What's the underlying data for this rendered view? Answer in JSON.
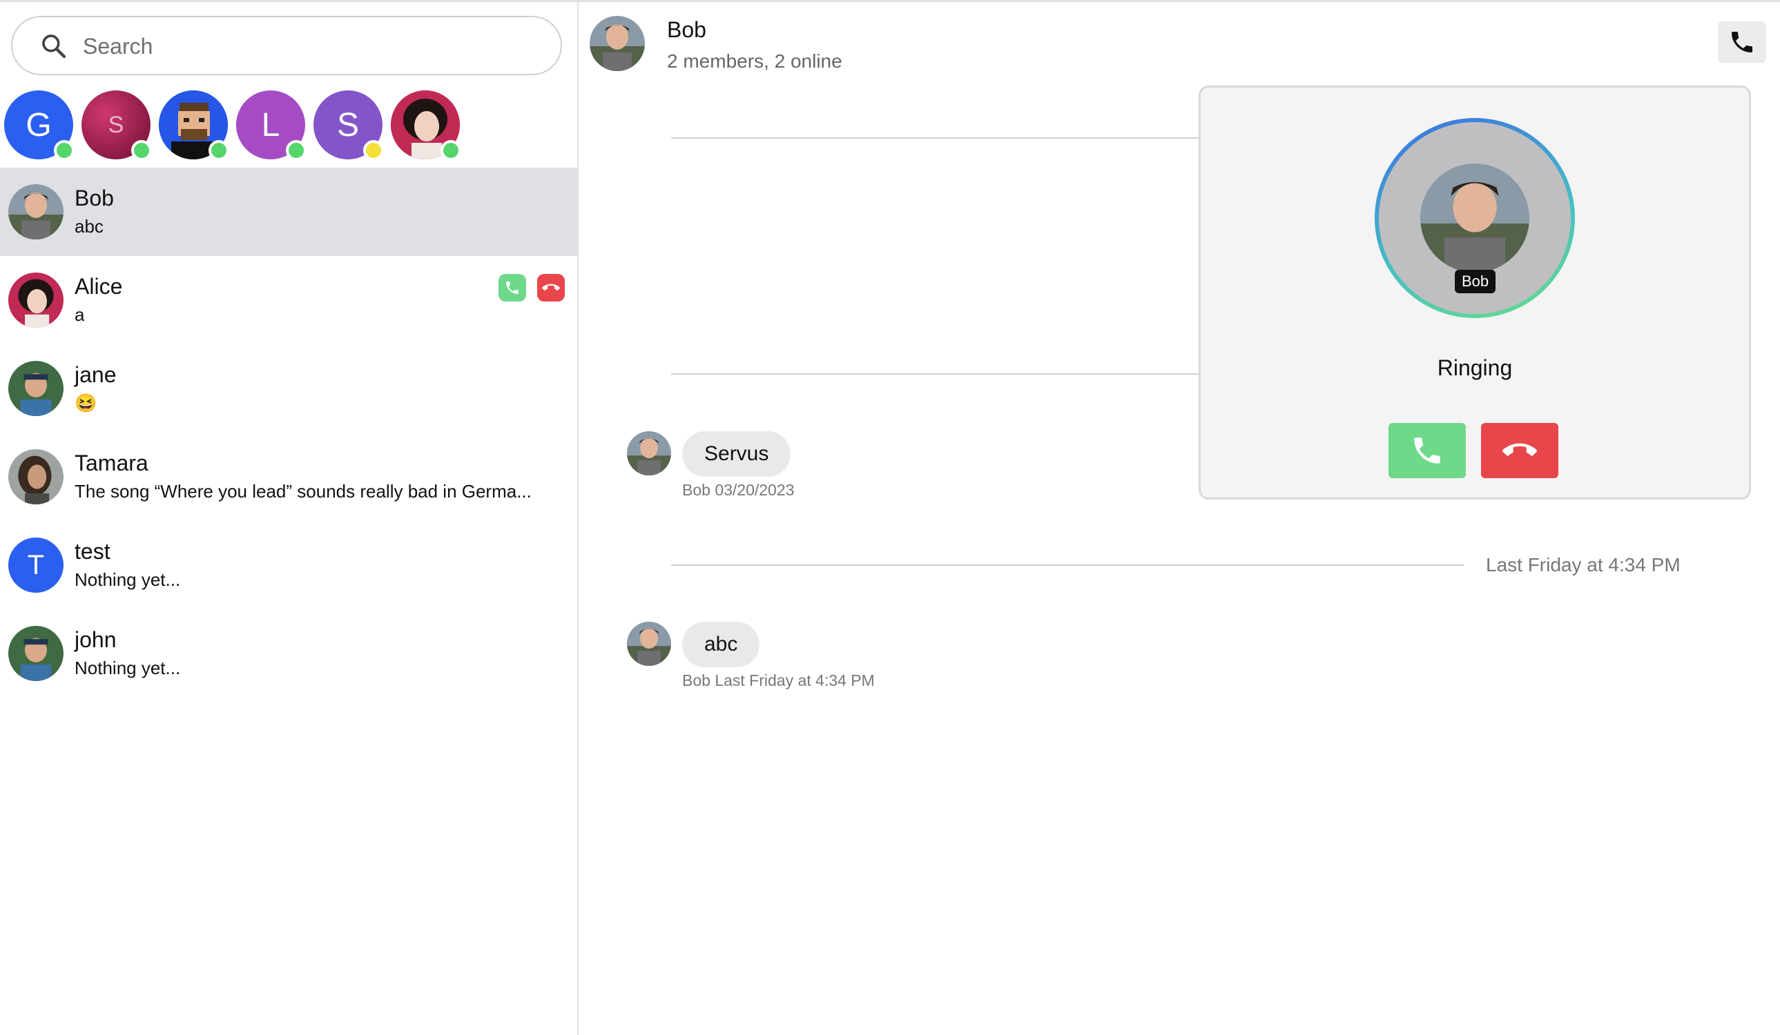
{
  "search": {
    "placeholder": "Search"
  },
  "online_users": [
    {
      "initial": "G",
      "color": "#2b5ff0",
      "status": "#55d66a"
    },
    {
      "initial": "S",
      "color": "#b0245a",
      "status": "#55d66a"
    },
    {
      "initial": "",
      "color": "#2556e6",
      "status": "#55d66a"
    },
    {
      "initial": "L",
      "color": "#a54cc4",
      "status": "#55d66a"
    },
    {
      "initial": "S",
      "color": "#8455c8",
      "status": "#f4e03a"
    },
    {
      "initial": "",
      "color": "#c02a55",
      "status": "#55d66a"
    }
  ],
  "chats": [
    {
      "name": "Bob",
      "preview": "abc"
    },
    {
      "name": "Alice",
      "preview": "a"
    },
    {
      "name": "jane",
      "preview": "😆"
    },
    {
      "name": "Tamara",
      "preview": "The song “Where you lead” sounds really bad in Germa..."
    },
    {
      "name": "test",
      "initial": "T",
      "preview": "Nothing yet..."
    },
    {
      "name": "john",
      "preview": "Nothing yet..."
    }
  ],
  "header": {
    "title": "Bob",
    "subtitle": "2 members, 2 online"
  },
  "messages": [
    {
      "text": "Servus",
      "meta": "Bob 03/20/2023"
    },
    {
      "text": "abc",
      "meta": "Bob Last Friday at 4:34 PM"
    }
  ],
  "separator": {
    "label": "Last Friday at 4:34 PM"
  },
  "call": {
    "caller_tag": "Bob",
    "status": "Ringing"
  },
  "colors": {
    "accept": "#6fd98a",
    "decline": "#e8464a",
    "selected_row": "#dfe0e3"
  }
}
